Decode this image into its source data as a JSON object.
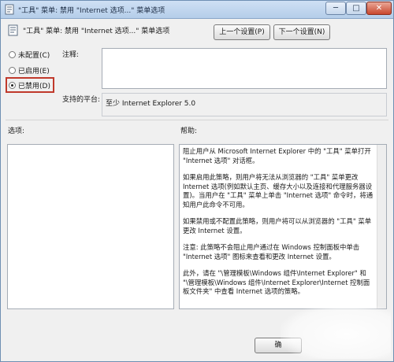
{
  "window": {
    "title": "\"工具\" 菜单: 禁用 \"Internet 选项...\" 菜单选项",
    "minimize_label": "─",
    "maximize_label": "□",
    "close_label": "✕"
  },
  "header": {
    "policy_title": "\"工具\" 菜单: 禁用 \"Internet 选项...\" 菜单选项",
    "prev_setting_label": "上一个设置(P)",
    "next_setting_label": "下一个设置(N)"
  },
  "state_options": [
    {
      "label": "未配置(C)",
      "checked": false
    },
    {
      "label": "已启用(E)",
      "checked": false
    },
    {
      "label": "已禁用(D)",
      "checked": true
    }
  ],
  "comment": {
    "label": "注释:",
    "value": ""
  },
  "supported_on": {
    "label": "支持的平台:",
    "value": "至少 Internet Explorer 5.0"
  },
  "options": {
    "label": "选项:"
  },
  "help": {
    "label": "帮助:",
    "paragraphs": [
      "阻止用户从 Microsoft Internet Explorer 中的 \"工具\" 菜单打开 \"Internet 选项\" 对话框。",
      "如果启用此策略，则用户将无法从浏览器的 \"工具\" 菜单更改 Internet 选项(例如默认主页、缓存大小以及连接和代理服务器设置)。当用户在 \"工具\" 菜单上单击 \"Internet 选项\" 命令时，将通知用户此命令不可用。",
      "如果禁用或不配置此策略，则用户将可以从浏览器的 \"工具\" 菜单更改 Internet 设置。",
      "注意: 此策略不会阻止用户通过在 Windows 控制面板中单击 \"Internet 选项\" 图标来查看和更改 Internet 设置。",
      "此外，请在 \"\\管理模板\\Windows 组件\\Internet Explorer\" 和 \"\\管理模板\\Windows 组件\\Internet Explorer\\Internet 控制面板文件夹\" 中查看 Internet 选项的策略。"
    ]
  },
  "footer": {
    "ok_label": "确"
  },
  "icons": {
    "title_icon": "policy-document-icon",
    "header_icon": "policy-document-icon"
  }
}
